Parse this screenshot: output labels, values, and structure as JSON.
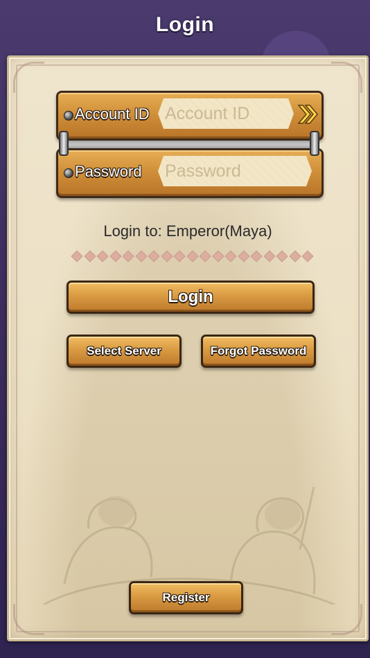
{
  "header": {
    "title": "Login"
  },
  "form": {
    "account_label": "Account ID",
    "account_placeholder": "Account ID",
    "account_value": "",
    "password_label": "Password",
    "password_placeholder": "Password",
    "password_value": ""
  },
  "server": {
    "text": "Login to: Emperor(Maya)"
  },
  "buttons": {
    "login": "Login",
    "select_server": "Select Server",
    "forgot_password": "Forgot Password",
    "register": "Register"
  },
  "icons": {
    "account_history": "double-chevron-right-icon",
    "field_bullet": "bullet-dot-icon"
  },
  "colors": {
    "background": "#3b2c5c",
    "panel": "#ece0c4",
    "wood": "#d99a42",
    "wood_border": "#3b2613",
    "text_dark": "#2a2a2a"
  }
}
